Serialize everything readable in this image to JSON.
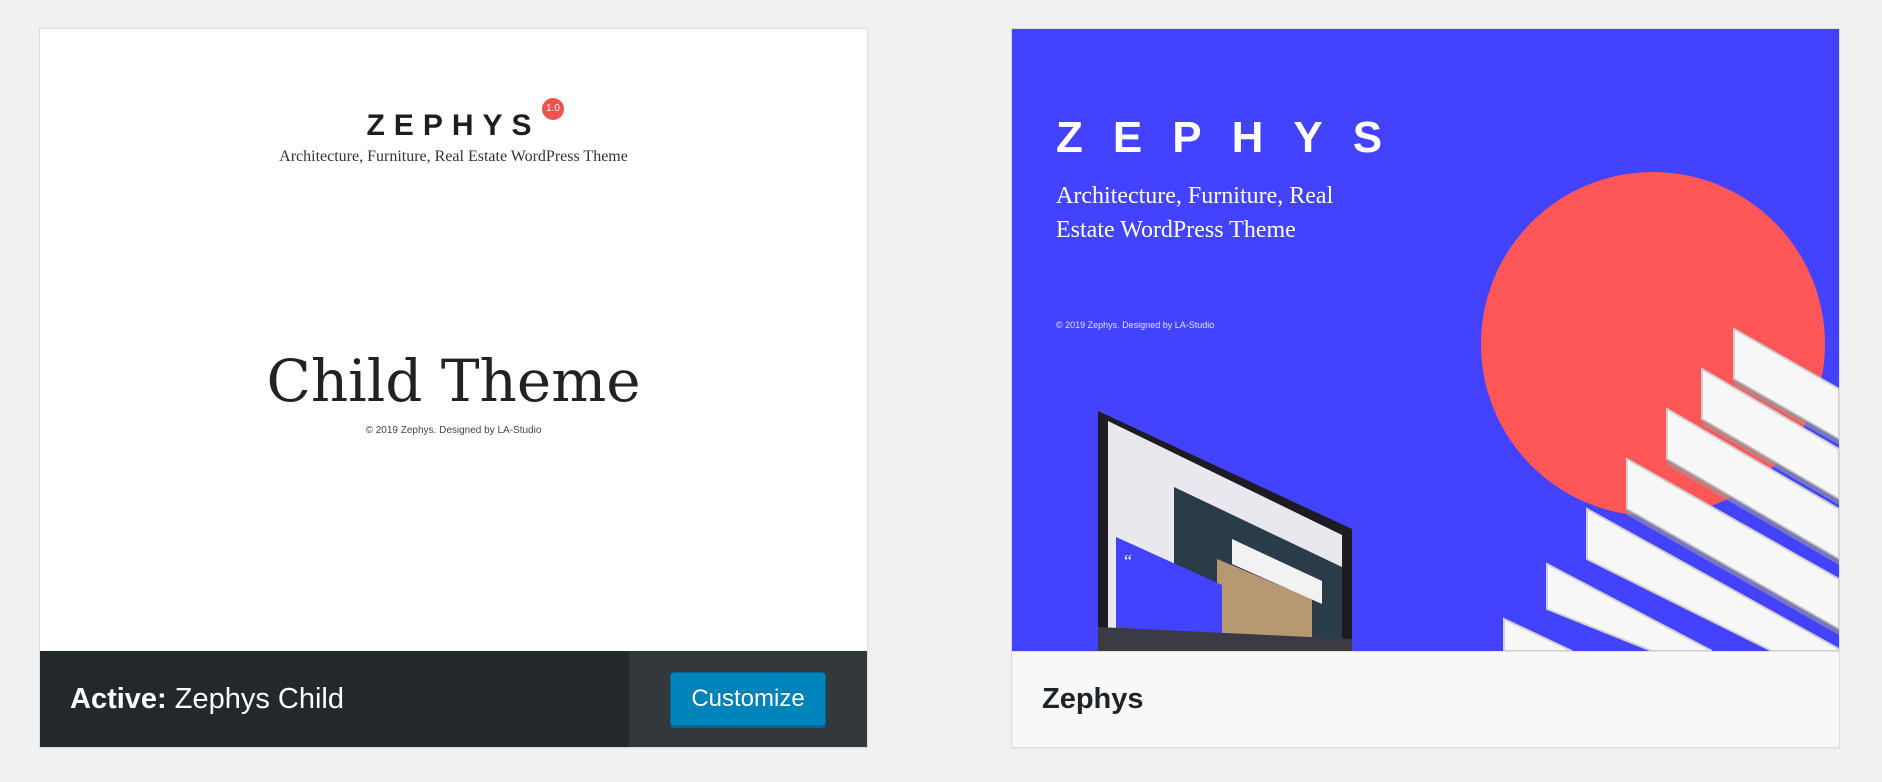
{
  "active_theme": {
    "screenshot": {
      "logo": "ZEPHYS",
      "version": "1.0",
      "tagline": "Architecture, Furniture, Real Estate WordPress Theme",
      "title": "Child Theme",
      "copyright": "© 2019 Zephys. Designed by LA-Studio"
    },
    "footer": {
      "active_label": "Active:",
      "name": "Zephys Child",
      "customize_label": "Customize"
    }
  },
  "parent_theme": {
    "screenshot": {
      "logo": "ZEPHYS",
      "tagline": "Architecture, Furniture, Real Estate WordPress Theme",
      "copyright": "© 2019 Zephys. Designed by LA-Studio"
    },
    "footer": {
      "name": "Zephys"
    }
  },
  "colors": {
    "page_bg": "#f1f1f1",
    "active_footer_bg": "#23282d",
    "button_blue": "#0085ba",
    "parent_shot_bg": "#4343ff",
    "sun": "#ff5757",
    "badge": "#ef5350"
  }
}
